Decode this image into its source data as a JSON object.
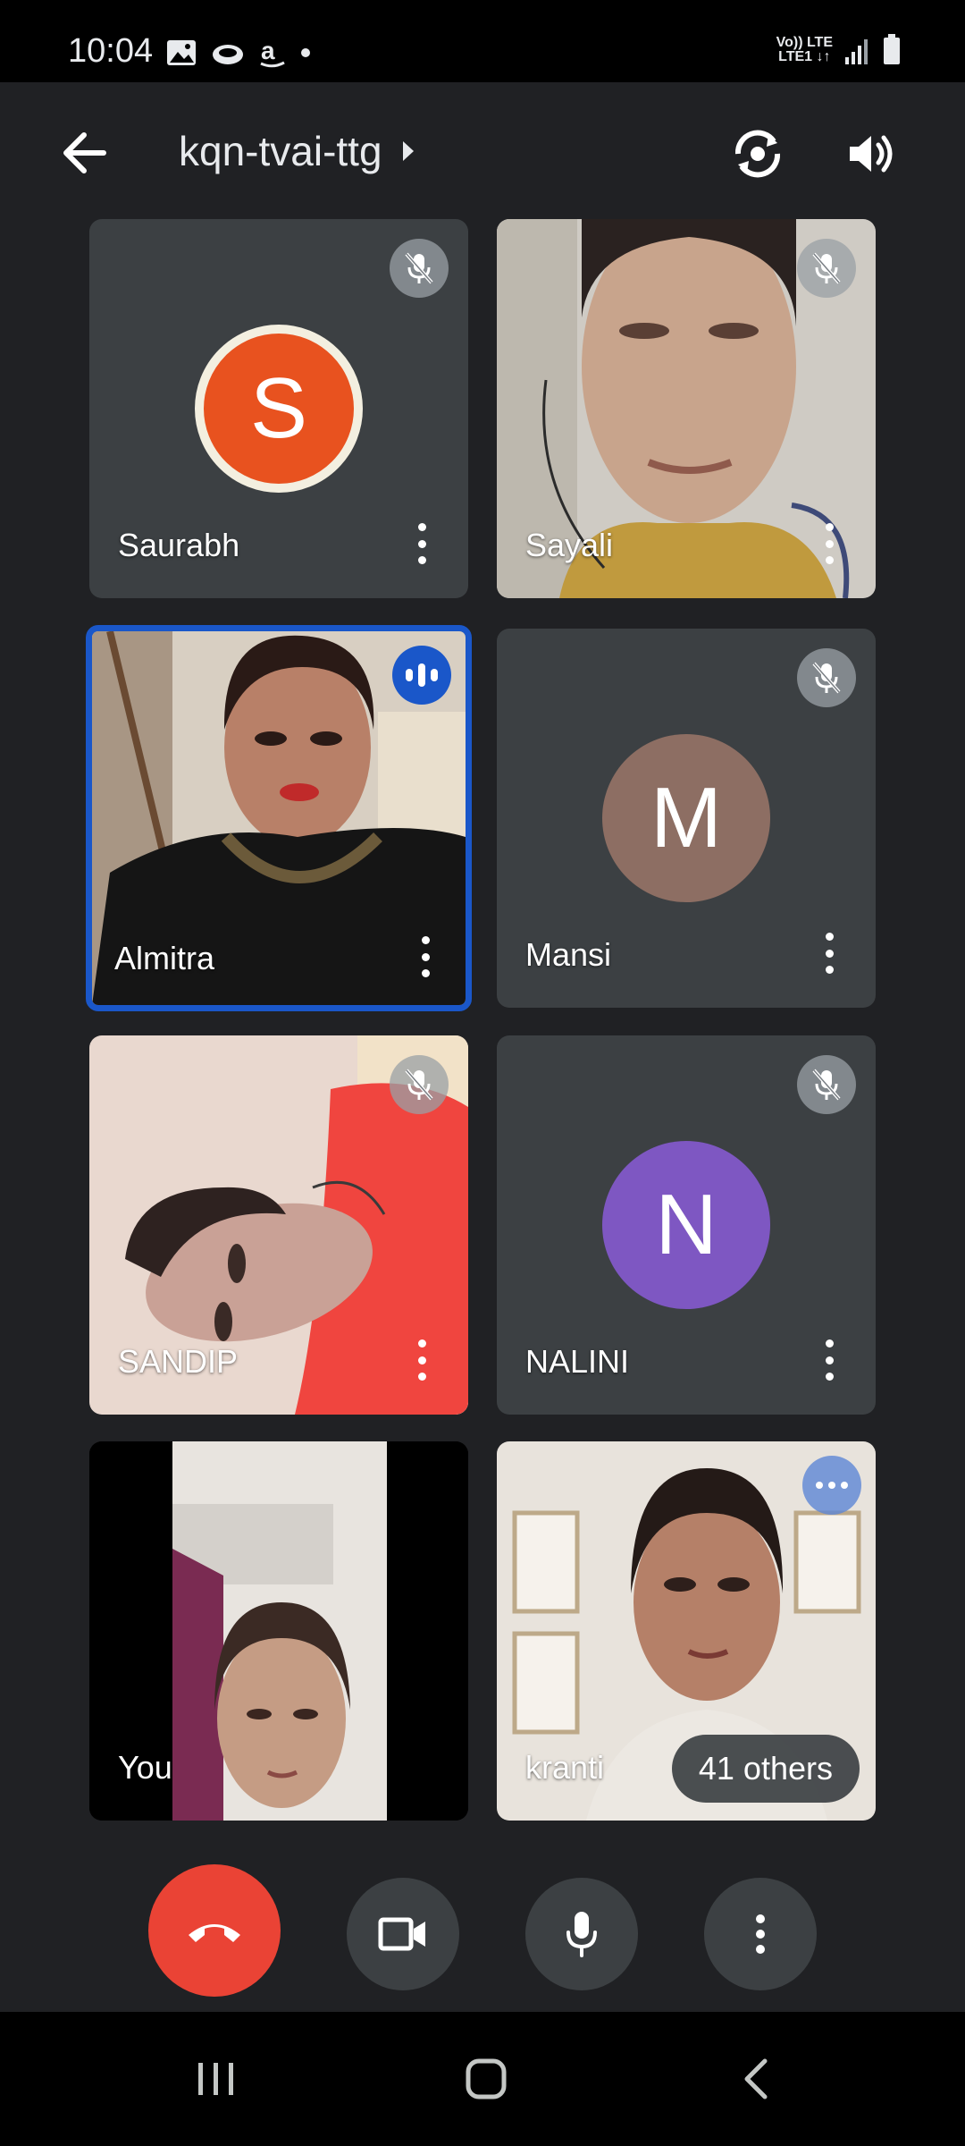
{
  "status_bar": {
    "time": "10:04",
    "icons": [
      "gallery-icon",
      "cloud-icon",
      "amazon-icon",
      "dot-icon"
    ],
    "network_top": "Vo)) LTE",
    "network_bottom": "LTE1 ↓↑"
  },
  "app_bar": {
    "meeting_code": "kqn-tvai-ttg"
  },
  "participants": [
    {
      "name": "Saurabh",
      "type": "avatar",
      "initial": "S",
      "avatar_color": "#e8521f",
      "muted": true
    },
    {
      "name": "Sayali",
      "type": "video",
      "muted": true
    },
    {
      "name": "Almitra",
      "type": "video",
      "speaking": true,
      "active": true
    },
    {
      "name": "Mansi",
      "type": "avatar",
      "initial": "M",
      "avatar_color": "#8d6e63",
      "muted": true
    },
    {
      "name": "SANDIP",
      "type": "video",
      "muted": true
    },
    {
      "name": "NALINI",
      "type": "avatar",
      "initial": "N",
      "avatar_color": "#7e57c2",
      "muted": true
    },
    {
      "name": "You",
      "type": "video",
      "self": true
    },
    {
      "name": "kranti",
      "type": "video"
    }
  ],
  "others_label": "41 others",
  "controls": [
    "end-call-icon",
    "camera-icon",
    "microphone-icon",
    "more-icon"
  ],
  "colors": {
    "background": "#202124",
    "tile": "#3c4043",
    "end_call": "#ea4335",
    "active_border": "#1a57c9"
  }
}
